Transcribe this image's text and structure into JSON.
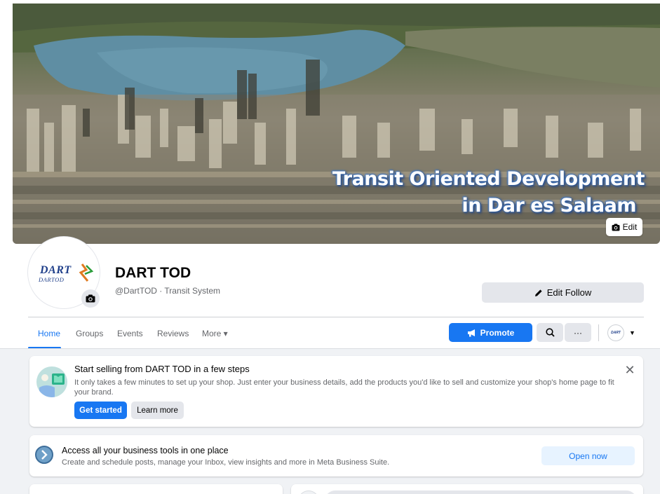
{
  "cover": {
    "title_line1": "Transit Oriented Development",
    "title_line2": "in Dar es Salaam",
    "edit_label": "Edit"
  },
  "profile": {
    "logo_text": "DART",
    "logo_subtext": "DARTOD",
    "name": "DART TOD",
    "handle": "@DartTOD · Transit System",
    "edit_follow_label": "Edit Follow"
  },
  "tabs": [
    {
      "label": "Home",
      "active": true
    },
    {
      "label": "Groups"
    },
    {
      "label": "Events"
    },
    {
      "label": "Reviews"
    },
    {
      "label": "More ▾"
    }
  ],
  "actions": {
    "promote_label": "Promote",
    "more_label": "···",
    "mini_avatar_text": "DART"
  },
  "shop_card": {
    "title": "Start selling from DART TOD in a few steps",
    "text": "It only takes a few minutes to set up your shop. Just enter your business details, add the products you'd like to sell and customize your shop's home page to fit your brand.",
    "primary_label": "Get started",
    "secondary_label": "Learn more",
    "close_label": "✕"
  },
  "business_card": {
    "title": "Access all your business tools in one place",
    "text": "Create and schedule posts, manage your Inbox, view insights and more in Meta Business Suite.",
    "button_label": "Open now"
  },
  "colors": {
    "accent": "#1877f2",
    "page_bg": "#f0f2f5",
    "secondary_button": "#e4e6eb",
    "muted_text": "#65676b"
  }
}
